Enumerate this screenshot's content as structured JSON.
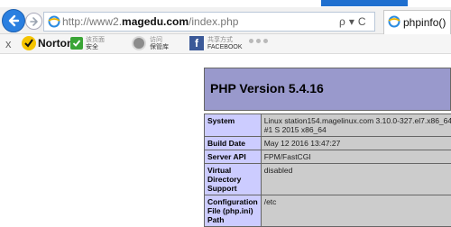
{
  "colors": {
    "accent_bar": "#1e6fcf",
    "php_header": "#9999cc",
    "key_cell": "#ccccff",
    "value_cell": "#cccccc"
  },
  "address_bar": {
    "url_prefix": "http://www2.",
    "url_domain": "magedu.com",
    "url_suffix": "/index.php",
    "search_glyph": "ρ",
    "dropdown_glyph": "▾",
    "refresh_glyph": "C"
  },
  "tab": {
    "label": "phpinfo()"
  },
  "toolbar": {
    "close_glyph": "x",
    "norton_label": "Norton",
    "dropdown_glyph": "▾",
    "safe_web_line1": "该页面",
    "safe_web_line2": "安全",
    "vault_line1": "访问",
    "vault_line2": "保管库",
    "share_line1": "共享方式",
    "share_line2": "FACEBOOK"
  },
  "phpinfo": {
    "title": "PHP Version 5.4.16",
    "rows": [
      {
        "key": "System",
        "value": "Linux station154.magelinux.com 3.10.0-327.el7.x86_64 #1 S 2015 x86_64"
      },
      {
        "key": "Build Date",
        "value": "May 12 2016 13:47:27"
      },
      {
        "key": "Server API",
        "value": "FPM/FastCGI"
      },
      {
        "key": "Virtual Directory Support",
        "value": "disabled"
      },
      {
        "key": "Configuration File (php.ini) Path",
        "value": "/etc"
      }
    ]
  }
}
